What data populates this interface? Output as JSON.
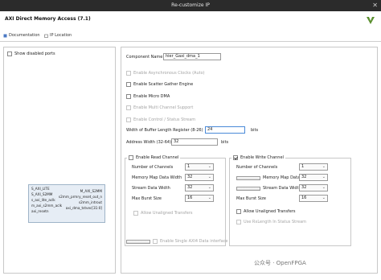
{
  "window": {
    "title": "Re-customize IP"
  },
  "header": {
    "title": "AXI Direct Memory Access (7.1)"
  },
  "tabs": [
    {
      "label": "Documentation"
    },
    {
      "label": "IP Location"
    }
  ],
  "left": {
    "show_disabled_ports": "Show disabled ports",
    "ports_left": [
      "S_AXI_LITE",
      "S_AXI_S2MM",
      "s_axi_lite_aclk",
      "m_axi_s2mm_aclk",
      "axi_resetn"
    ],
    "ports_right": [
      "M_AXI_S2MM",
      "s2mm_prmry_reset_out_n",
      "s2mm_introut",
      "axi_dma_tstvec[31:0]"
    ]
  },
  "right": {
    "component_name_label": "Component Name",
    "component_name_value": "hier_Gaxi_dma_1",
    "enable_async_clocks": "Enable Asynchronous Clocks (Auto)",
    "enable_sg": "Enable Scatter Gather Engine",
    "enable_micro_dma": "Enable Micro DMA",
    "enable_multi_channel": "Enable Multi Channel Support",
    "enable_control_status": "Enable Control / Status Stream",
    "buffer_len_label": "Width of Buffer Length Register (8-26)",
    "buffer_len_value": "24",
    "bits1": "bits",
    "addr_width_label": "Address Width (32-64)",
    "addr_width_value": "32",
    "bits2": "bits",
    "read_channel": {
      "title": "Enable Read Channel",
      "num_channels_label": "Number of Channels",
      "num_channels_value": "1",
      "mm_width_label": "Memory Map Data Width",
      "mm_width_value": "32",
      "stream_width_label": "Stream Data Width",
      "stream_width_value": "32",
      "burst_label": "Max Burst Size",
      "burst_value": "16",
      "allow_unaligned": "Allow Unaligned Transfers"
    },
    "write_channel": {
      "title": "Enable Write Channel",
      "num_channels_label": "Number of Channels",
      "num_channels_value": "1",
      "mm_width_label": "Memory Map Data Width",
      "mm_width_value": "32",
      "stream_width_label": "Stream Data Width",
      "stream_width_value": "32",
      "burst_label": "Max Burst Size",
      "burst_value": "16",
      "allow_unaligned": "Allow Unaligned Transfers",
      "use_rxlength": "Use RxLength In Status Stream"
    },
    "single_axi4": "Enable Single AXI4 Data interface"
  },
  "watermark": {
    "text": "公众号 · OpenFPGA"
  }
}
